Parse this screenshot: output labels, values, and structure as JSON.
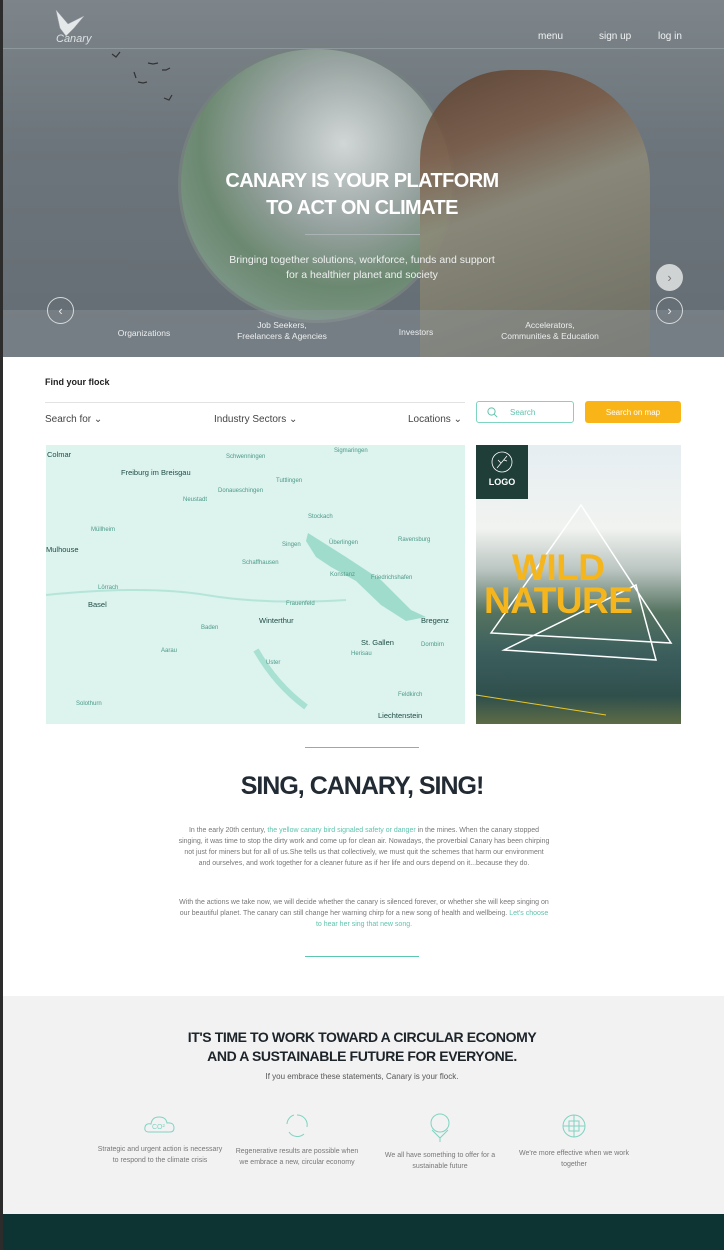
{
  "header": {
    "logo_text": "Canary",
    "nav": [
      "menu",
      "sign up",
      "log in"
    ]
  },
  "hero": {
    "title_line1": "CANARY IS YOUR PLATFORM",
    "title_line2": "TO  ACT ON CLIMATE",
    "subtitle_line1": "Bringing together solutions, workforce, funds and support",
    "subtitle_line2": "for a healthier planet and society",
    "prev_icon": "‹",
    "next_icon": "›",
    "categories": [
      {
        "line1": "Organizations",
        "line2": ""
      },
      {
        "line1": "Job Seekers,",
        "line2": "Freelancers & Agencies"
      },
      {
        "line1": "Investors",
        "line2": ""
      },
      {
        "line1": "Accelerators,",
        "line2": "Communities & Education"
      }
    ]
  },
  "find": {
    "title": "Find your flock",
    "filters": [
      "Search for",
      "Industry Sectors",
      "Locations"
    ],
    "search_label": "Search",
    "map_button": "Search on map"
  },
  "map": {
    "labels": [
      "Colmar",
      "Freiburg im Breisgau",
      "Mulhouse",
      "Basel",
      "Winterthur",
      "Schaffhausen",
      "St. Gallen",
      "Bregenz",
      "Liechtenstein",
      "Konstanz",
      "Friedrichshafen",
      "Singen",
      "Tuttlingen",
      "Ravensburg",
      "Lörrach",
      "Baden",
      "Frauenfeld",
      "Aarau",
      "Solothurn",
      "Uster",
      "Herisau",
      "Dornbirn",
      "Feldkirch",
      "Sigmaringen",
      "Schwenningen",
      "Donaueschingen",
      "Neustadt",
      "Stockach",
      "Überlingen",
      "Müllheim"
    ]
  },
  "ad": {
    "logo": "LOGO",
    "line1": "WILD",
    "line2": "NATURE",
    "accent": "#f5b51d"
  },
  "sing": {
    "title": "SING, CANARY, SING!",
    "p1_a": "In the early 20th century, ",
    "p1_link": "the yellow canary bird signaled safety or danger",
    "p1_b": " in the mines. When the canary stopped singing, it was time to stop the dirty work and come up for clean air. Nowadays, the proverbial Canary has been chirping not just for miners but for all of us.She tells us that collectively, we must quit the schemes that harm our environment and ourselves, and work together for a cleaner future as if her life and ours depend on it...because they do.",
    "p2_a": "With the actions we take now, we will decide whether the canary is silenced forever, or whether she will keep singing on our beautiful planet. The canary can still change her warning chirp for a new song of health and wellbeing. ",
    "p2_link": "Let's choose to hear her sing that new song."
  },
  "circular": {
    "title_line1": "IT'S TIME TO WORK TOWARD A CIRCULAR ECONOMY",
    "title_line2": "AND A SUSTAINABLE FUTURE FOR EVERYONE.",
    "subtitle": "If you embrace these statements, Canary is your flock.",
    "features": [
      {
        "icon": "co2-cloud-icon",
        "text": "Strategic and urgent action is necessary to respond to the climate crisis"
      },
      {
        "icon": "recycle-leaves-icon",
        "text": "Regenerative results are possible when we embrace a new, circular economy"
      },
      {
        "icon": "hands-globe-icon",
        "text": "We all have something to offer for a sustainable future"
      },
      {
        "icon": "connected-globe-icon",
        "text": "We're more effective when we work together"
      }
    ]
  },
  "colors": {
    "accent_teal": "#5ec3ae",
    "accent_yellow": "#f9b518",
    "footer": "#0d3433"
  }
}
